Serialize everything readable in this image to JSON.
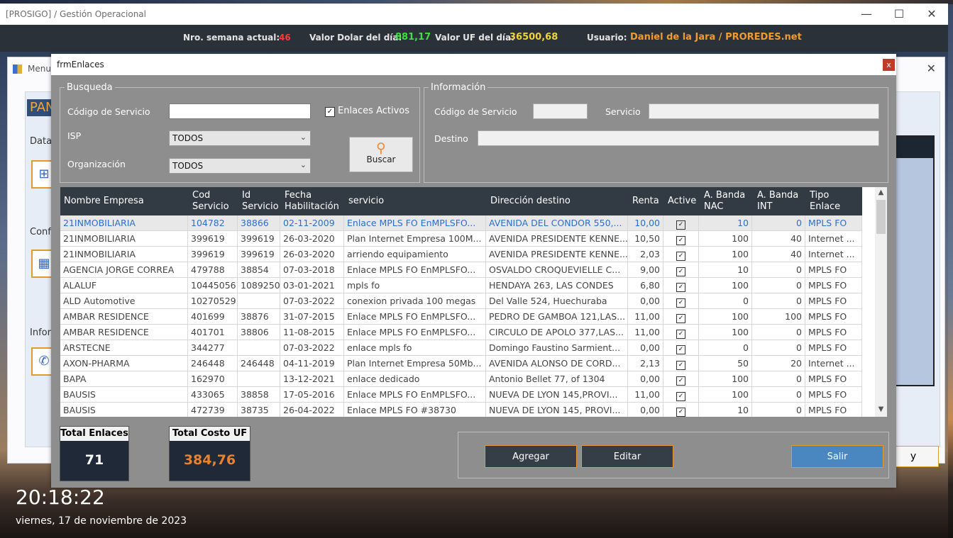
{
  "main": {
    "title": "[PROSIGO]  / Gestión Operacional",
    "controls": {
      "minimize": "—",
      "maximize": "☐",
      "close": "✕"
    }
  },
  "info_bar": {
    "week_label": "Nro. semana actual:",
    "week_value": "46",
    "dolar_label": "Valor Dolar del día:",
    "dolar_value": "881,17",
    "uf_label": "Valor UF del día:",
    "uf_value": "36500,68",
    "user_label": "Usuario:",
    "user_value": "Daniel de la Jara / PROREDES.net"
  },
  "menu_window": {
    "title": "Menu",
    "pan_tag": "PAN",
    "side_labels": [
      "Datac",
      "Confi",
      "Inforr"
    ],
    "right_button": "y"
  },
  "clock": {
    "time": "20:18:22",
    "date": "viernes, 17 de noviembre de 2023"
  },
  "dialog": {
    "title": "frmEnlaces",
    "close": "x",
    "busqueda": {
      "legend": "Busqueda",
      "codigo_label": "Código de Servicio",
      "codigo_value": "",
      "activos_label": "Enlaces Activos",
      "activos_checked": "✓",
      "isp_label": "ISP",
      "isp_value": "TODOS",
      "org_label": "Organización",
      "org_value": "TODOS",
      "buscar_label": "Buscar"
    },
    "informacion": {
      "legend": "Información",
      "codigo_label": "Código de Servicio",
      "servicio_label": "Servicio",
      "destino_label": "Destino"
    },
    "grid": {
      "headers": [
        {
          "l1": "Nombre Empresa",
          "l2": ""
        },
        {
          "l1": "Cod",
          "l2": "Servicio"
        },
        {
          "l1": "Id",
          "l2": "Servicio"
        },
        {
          "l1": "Fecha",
          "l2": "Habilitación"
        },
        {
          "l1": "servicio",
          "l2": ""
        },
        {
          "l1": "Dirección destino",
          "l2": ""
        },
        {
          "l1": "Renta",
          "l2": ""
        },
        {
          "l1": "Active",
          "l2": ""
        },
        {
          "l1": "A. Banda",
          "l2": "NAC"
        },
        {
          "l1": "A. Banda",
          "l2": "INT"
        },
        {
          "l1": "Tipo",
          "l2": "Enlace"
        }
      ],
      "rows": [
        [
          "21INMOBILIARIA",
          "104782",
          "38866",
          "02-11-2009",
          "Enlace MPLS FO  EnMPLSFO...",
          "AVENIDA DEL CONDOR 550,...",
          "10,00",
          "✓",
          "10",
          "0",
          "MPLS FO"
        ],
        [
          "21INMOBILIARIA",
          "399619",
          "399619",
          "26-03-2020",
          "Plan Internet Empresa 100M...",
          "AVENIDA PRESIDENTE KENNE...",
          "10,50",
          "✓",
          "100",
          "40",
          "Internet ..."
        ],
        [
          "21INMOBILIARIA",
          "399619",
          "399619",
          "26-03-2020",
          "arriendo equipamiento",
          "AVENIDA PRESIDENTE KENNE...",
          "2,03",
          "✓",
          "100",
          "40",
          "Internet ..."
        ],
        [
          "AGENCIA JORGE CORREA",
          "479788",
          "38854",
          "07-03-2018",
          "Enlace MPLS FO  EnMPLSFO...",
          "OSVALDO CROQUEVIELLE C...",
          "9,00",
          "✓",
          "10",
          "0",
          "MPLS FO"
        ],
        [
          "ALALUF",
          "10445056",
          "1089250",
          "03-01-2021",
          "mpls fo",
          "HENDAYA 263, LAS CONDES",
          "6,80",
          "✓",
          "100",
          "0",
          "MPLS FO"
        ],
        [
          "ALD Automotive",
          "10270529",
          "",
          "07-03-2022",
          "conexion privada 100 megas",
          "Del Valle 524, Huechuraba",
          "0,00",
          "✓",
          "0",
          "0",
          "MPLS FO"
        ],
        [
          "AMBAR RESIDENCE",
          "401699",
          "38876",
          "31-07-2015",
          "Enlace MPLS FO  EnMPLSFO...",
          "PEDRO DE GAMBOA 121,LAS...",
          "11,00",
          "✓",
          "100",
          "100",
          "MPLS FO"
        ],
        [
          "AMBAR RESIDENCE",
          "401701",
          "38806",
          "11-08-2015",
          "Enlace MPLS FO  EnMPLSFO...",
          "CIRCULO DE APOLO 377,LAS...",
          "11,00",
          "✓",
          "100",
          "0",
          "MPLS FO"
        ],
        [
          "ARSTECNE",
          "344277",
          "",
          "07-03-2022",
          "enlace mpls fo",
          "Domingo Faustino Sarmient...",
          "0,00",
          "✓",
          "0",
          "0",
          "MPLS FO"
        ],
        [
          "AXON-PHARMA",
          "246448",
          "246448",
          "04-11-2019",
          "Plan Internet Empresa 50Mb...",
          "AVENIDA ALONSO DE CORD...",
          "2,13",
          "✓",
          "50",
          "20",
          "Internet ..."
        ],
        [
          "BAPA",
          "162970",
          "",
          "13-12-2021",
          "enlace dedicado",
          "Antonio Bellet 77, of 1304",
          "0,00",
          "✓",
          "100",
          "0",
          "MPLS FO"
        ],
        [
          "BAUSIS",
          "433065",
          "38858",
          "17-05-2016",
          "Enlace MPLS FO  EnMPLSFO...",
          "NUEVA DE LYON 145,PROVI...",
          "11,00",
          "✓",
          "100",
          "0",
          "MPLS FO"
        ],
        [
          "BAUSIS",
          "472739",
          "38735",
          "26-04-2022",
          "Enlace MPLS FO #38730",
          "NUEVA DE LYON 145, PROVI...",
          "0,00",
          "✓",
          "10",
          "0",
          "MPLS FO"
        ]
      ]
    },
    "totals": {
      "enlaces_label": "Total Enlaces",
      "enlaces_value": "71",
      "costo_label": "Total Costo UF",
      "costo_value": "384,76"
    },
    "buttons": {
      "agregar": "Agregar",
      "editar": "Editar",
      "salir": "Salir"
    }
  }
}
